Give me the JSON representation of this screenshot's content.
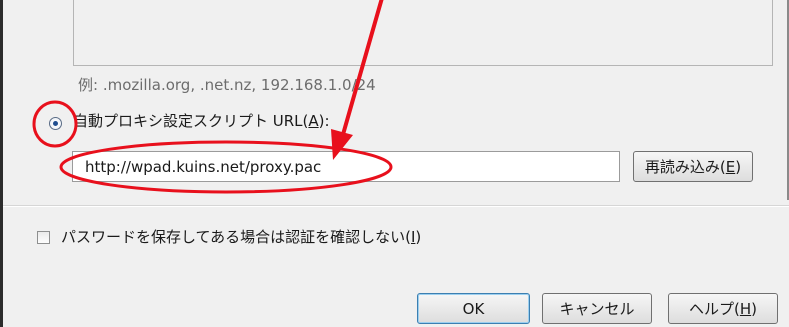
{
  "proxy": {
    "example_text": "例: .mozilla.org, .net.nz, 192.168.1.0/24",
    "auto_config_label_pre": "自動プロキシ設定スクリプト URL(",
    "auto_config_label_key": "A",
    "auto_config_label_post": "):",
    "auto_config_selected": true,
    "pac_url": "http://wpad.kuins.net/proxy.pac",
    "reload_label_pre": "再読み込み(",
    "reload_label_key": "E",
    "reload_label_post": ")",
    "no_auth_prompt_label_pre": "パスワードを保存してある場合は認証を確認しない(",
    "no_auth_prompt_label_key": "I",
    "no_auth_prompt_label_post": ")",
    "no_auth_prompt_checked": false
  },
  "footer": {
    "ok_label": "OK",
    "cancel_label": "キャンセル",
    "help_label_pre": "ヘルプ(",
    "help_label_key": "H",
    "help_label_post": ")"
  },
  "annotation": {
    "color": "#e8101c"
  }
}
